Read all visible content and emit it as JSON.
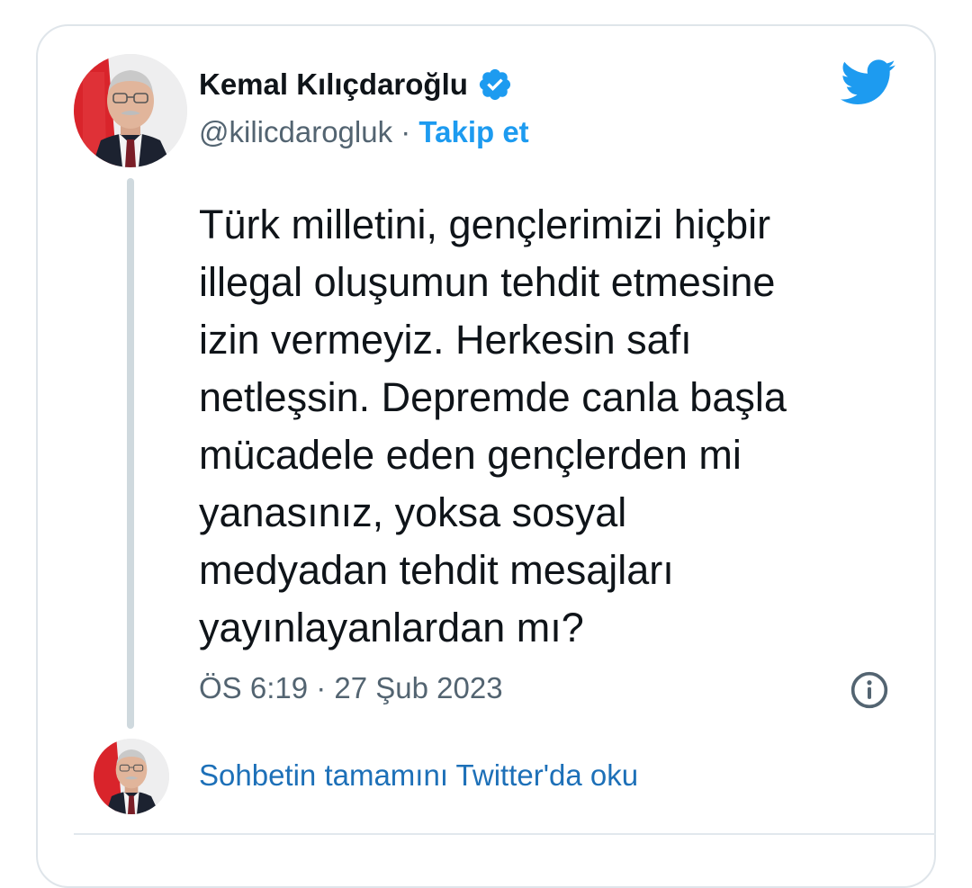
{
  "author": {
    "display_name": "Kemal Kılıçdaroğlu",
    "handle": "@kilicdarogluk",
    "separator": " · ",
    "follow_label": "Takip et",
    "verified": true
  },
  "tweet": {
    "text_lines": [
      "Türk milletini, gençlerimizi hiçbir",
      "illegal oluşumun tehdit etmesine",
      "izin vermeyiz. Herkesin safı",
      "netleşsin. Depremde canla başla",
      "mücadele eden gençlerden mi",
      "yanasınız, yoksa sosyal",
      "medyadan tehdit mesajları",
      "yayınlayanlardan mı?"
    ],
    "timestamp": "ÖS 6:19 · 27 Şub 2023"
  },
  "footer": {
    "read_more_label": "Sohbetin tamamını Twitter'da oku"
  },
  "icons": {
    "brand": "twitter-bird-icon",
    "verified": "verified-badge-icon",
    "info": "info-circle-icon"
  },
  "colors": {
    "brand_blue": "#1d9bf0",
    "link_blue": "#1d70b8",
    "text_primary": "#0f1419",
    "text_secondary": "#536471",
    "border": "#dfe5ea"
  }
}
